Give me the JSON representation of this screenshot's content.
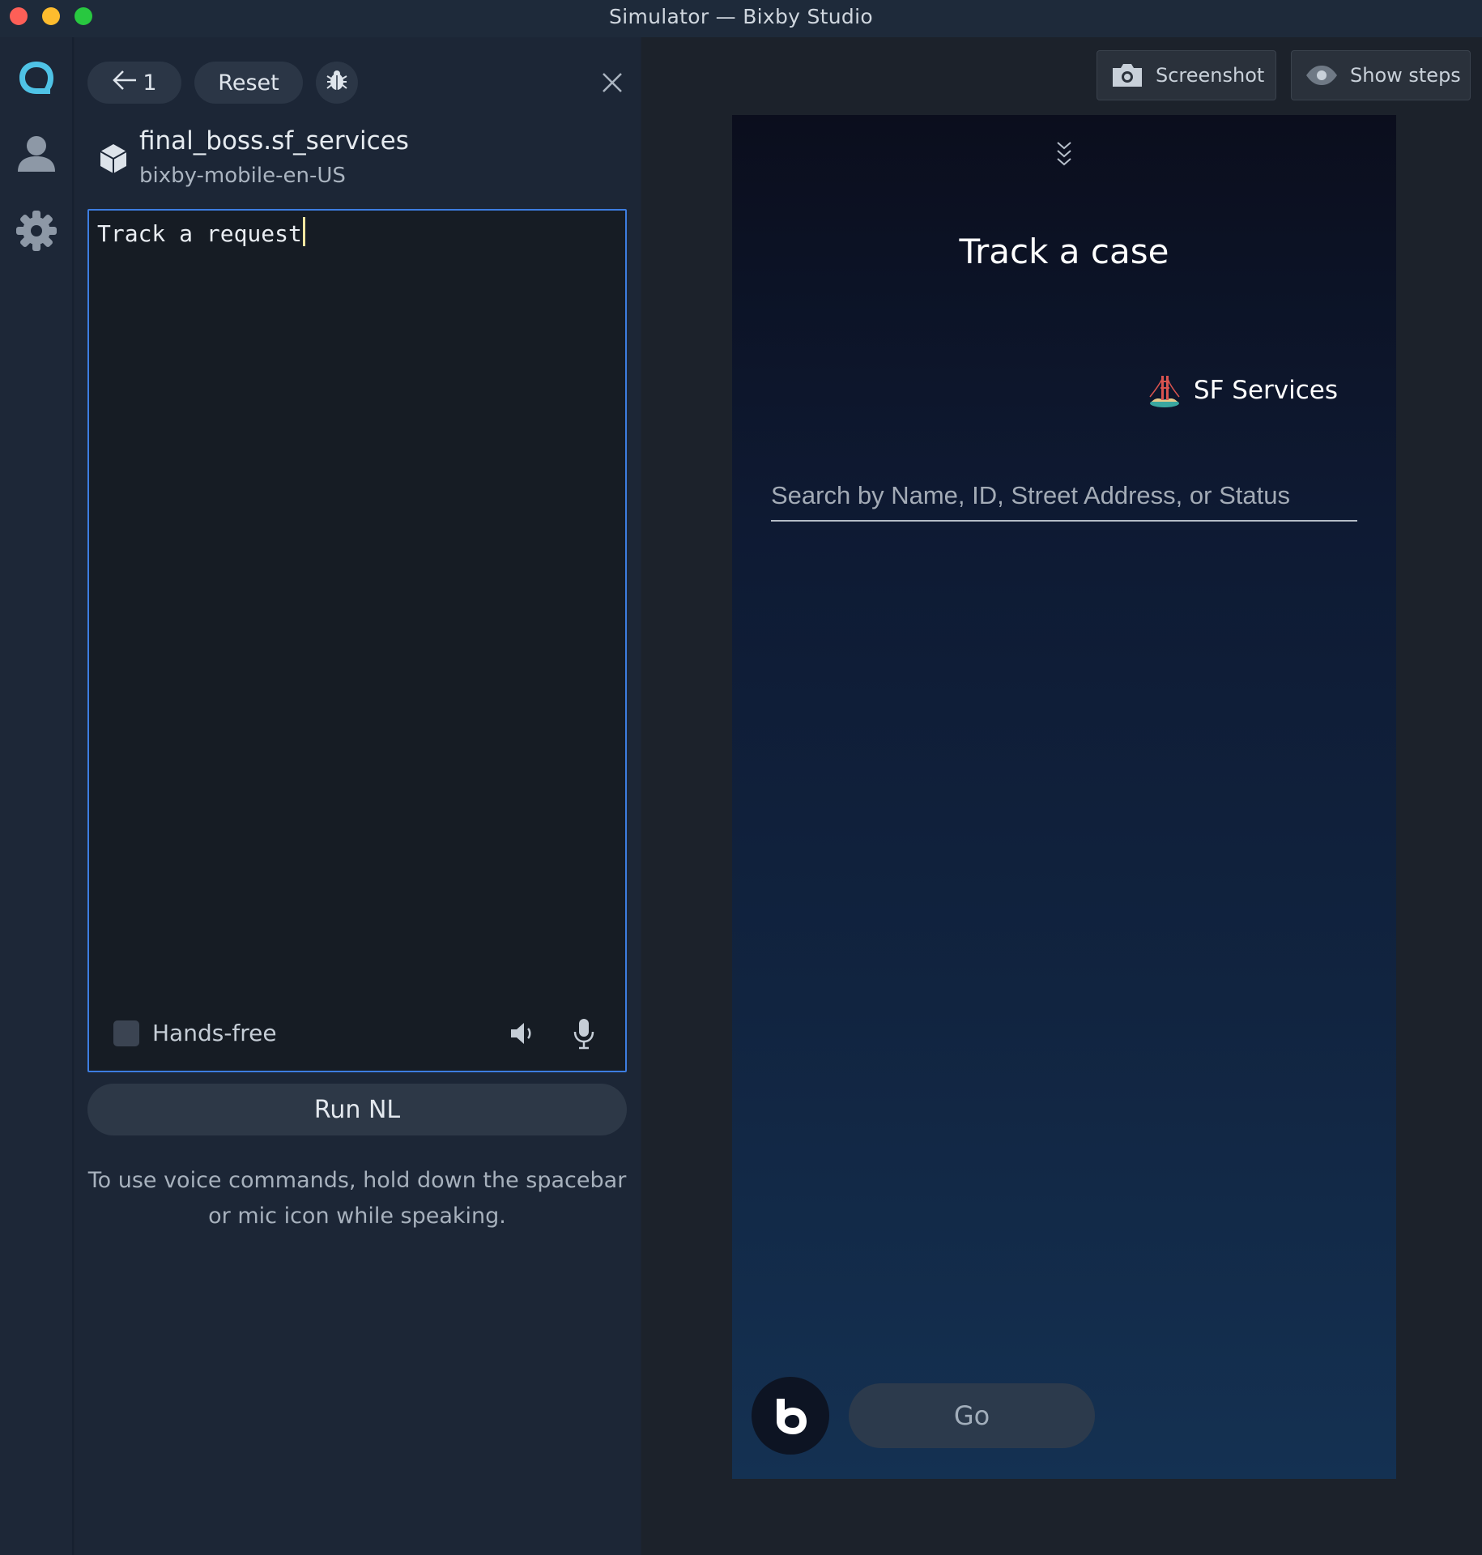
{
  "window": {
    "title": "Simulator — Bixby Studio"
  },
  "rail": {
    "icons": [
      "bixby-logo-icon",
      "user-icon",
      "gear-icon"
    ]
  },
  "toolbar": {
    "back_count": "1",
    "reset_label": "Reset"
  },
  "capsule": {
    "name": "final_boss.sf_services",
    "target": "bixby-mobile-en-US"
  },
  "editor": {
    "utterance": "Track a request",
    "handsfree_label": "Hands-free",
    "handsfree_checked": false
  },
  "run_label": "Run NL",
  "help_text": "To use voice commands, hold down the spacebar or mic icon while speaking.",
  "device_toolbar": {
    "screenshot_label": "Screenshot",
    "show_steps_label": "Show steps"
  },
  "screen": {
    "title": "Track a case",
    "capsule_label": "SF Services",
    "search_placeholder": "Search by Name, ID, Street Address, or Status",
    "go_label": "Go"
  },
  "colors": {
    "editor_focus_border": "#3d7de0",
    "rail_logo": "#4fc3e6",
    "background": "#1b2432"
  }
}
